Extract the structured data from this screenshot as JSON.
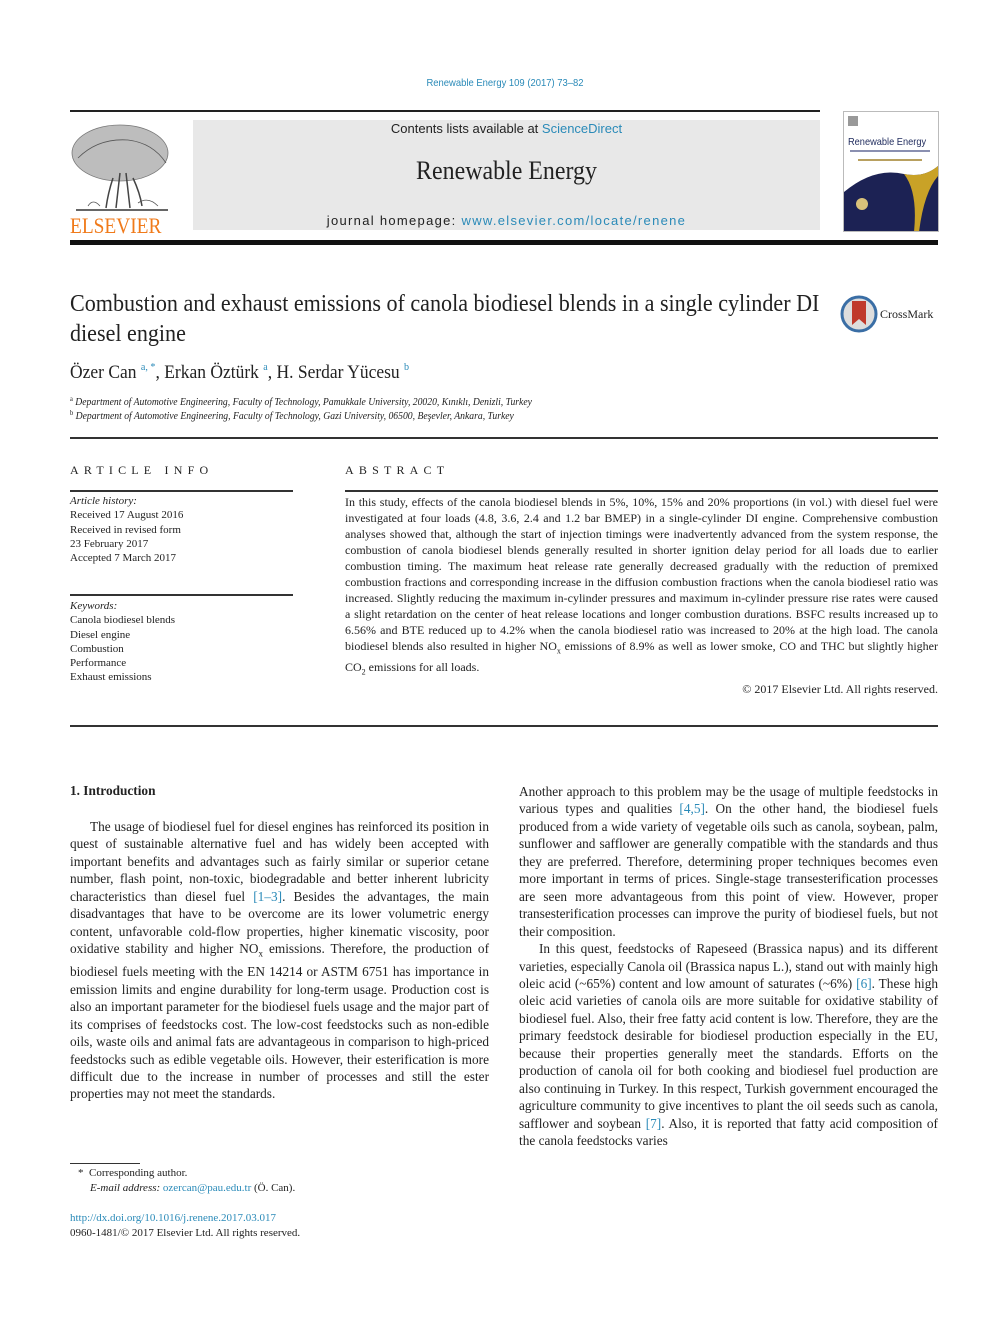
{
  "header": {
    "journal_ref": "Renewable Energy 109 (2017) 73–82",
    "contents_prefix": "Contents lists available at ",
    "contents_link": "ScienceDirect",
    "journal_name": "Renewable Energy",
    "homepage_prefix": "journal homepage: ",
    "homepage_link": "www.elsevier.com/locate/renene",
    "publisher_logo_text": "ELSEVIER",
    "cover_title": "Renewable Energy",
    "crossmark_label": "CrossMark"
  },
  "article": {
    "title": "Combustion and exhaust emissions of canola biodiesel blends in a single cylinder DI diesel engine",
    "authors": [
      {
        "name": "Özer Can",
        "affil": "a, *"
      },
      {
        "name": "Erkan Öztürk",
        "affil": "a"
      },
      {
        "name": "H. Serdar Yücesu",
        "affil": "b"
      }
    ],
    "affiliations": [
      {
        "mark": "a",
        "text": "Department of Automotive Engineering, Faculty of Technology, Pamukkale University, 20020, Kınıklı, Denizli, Turkey"
      },
      {
        "mark": "b",
        "text": "Department of Automotive Engineering, Faculty of Technology, Gazi University, 06500, Beşevler, Ankara, Turkey"
      }
    ]
  },
  "article_info": {
    "heading": "ARTICLE INFO",
    "history_label": "Article history:",
    "history": [
      "Received 17 August 2016",
      "Received in revised form",
      "23 February 2017",
      "Accepted 7 March 2017"
    ],
    "keywords_label": "Keywords:",
    "keywords": [
      "Canola biodiesel blends",
      "Diesel engine",
      "Combustion",
      "Performance",
      "Exhaust emissions"
    ]
  },
  "abstract": {
    "heading": "ABSTRACT",
    "text_1": "In this study, effects of the canola biodiesel blends in 5%, 10%, 15% and 20% proportions (in vol.) with diesel fuel were investigated at four loads (4.8, 3.6, 2.4 and 1.2 bar BMEP) in a single-cylinder DI engine. Comprehensive combustion analyses showed that, although the start of injection timings were inadvertently advanced from the system response, the combustion of canola biodiesel blends generally resulted in shorter ignition delay period for all loads due to earlier combustion timing. The maximum heat release rate generally decreased gradually with the reduction of premixed combustion fractions and corresponding increase in the diffusion combustion fractions when the canola biodiesel ratio was increased. Slightly reducing the maximum in-cylinder pressures and maximum in-cylinder pressure rise rates were caused a slight retardation on the center of heat release locations and longer combustion durations. BSFC results increased up to 6.56% and BTE reduced up to 4.2% when the canola biodiesel ratio was increased to 20% at the high load. The canola biodiesel blends also resulted in higher NO",
    "sub_1": "x",
    "text_2": " emissions of 8.9% as well as lower smoke, CO and THC but slightly higher CO",
    "sub_2": "2",
    "text_3": " emissions for all loads.",
    "copyright": "© 2017 Elsevier Ltd. All rights reserved."
  },
  "body": {
    "section_heading": "1.  Introduction",
    "left_p1_a": "The usage of biodiesel fuel for diesel engines has reinforced its position in quest of sustainable alternative fuel and has widely been accepted with important benefits and advantages such as fairly similar or superior cetane number, flash point, non-toxic, biodegradable and better inherent lubricity characteristics than diesel fuel ",
    "left_p1_ref": "[1–3]",
    "left_p1_b": ". Besides the advantages, the main disadvantages that have to be overcome are its lower volumetric energy content, unfavorable cold-flow properties, higher kinematic viscosity, poor oxidative stability and higher NO",
    "left_p1_sub": "x",
    "left_p1_c": " emissions. Therefore, the production of biodiesel fuels meeting with the EN 14214 or ASTM 6751 has importance in emission limits and engine durability for long-term usage. Production cost is also an important parameter for the biodiesel fuels usage and the major part of its comprises of feedstocks cost. The low-cost feedstocks such as non-edible oils, waste oils and animal fats are advantageous in comparison to high-priced feedstocks such as edible vegetable oils. However, their esterification is more difficult due to the increase in number of processes and still the ester properties may not meet the standards.",
    "right_p1_a": "Another approach to this problem may be the usage of multiple feedstocks in various types and qualities ",
    "right_p1_ref": "[4,5]",
    "right_p1_b": ". On the other hand, the biodiesel fuels produced from a wide variety of vegetable oils such as canola, soybean, palm, sunflower and safflower are generally compatible with the standards and thus they are preferred. Therefore, determining proper techniques becomes even more important in terms of prices. Single-stage transesterification processes are seen more advantageous from this point of view. However, proper transesterification processes can improve the purity of biodiesel fuels, but not their composition.",
    "right_p2_a": "In this quest, feedstocks of Rapeseed (Brassica napus) and its different varieties, especially Canola oil (Brassica napus L.), stand out with mainly high oleic acid (~65%) content and low amount of saturates (~6%) ",
    "right_p2_ref1": "[6]",
    "right_p2_b": ". These high oleic acid varieties of canola oils are more suitable for oxidative stability of biodiesel fuel. Also, their free fatty acid content is low. Therefore, they are the primary feedstock desirable for biodiesel production especially in the EU, because their properties generally meet the standards. Efforts on the production of canola oil for both cooking and biodiesel fuel production are also continuing in Turkey. In this respect, Turkish government encouraged the agriculture community to give incentives to plant the oil seeds such as canola, safflower and soybean ",
    "right_p2_ref2": "[7]",
    "right_p2_c": ". Also, it is reported that fatty acid composition of the canola feedstocks varies"
  },
  "footnotes": {
    "star": "*",
    "corresponding": "Corresponding author.",
    "email_label": "E-mail address: ",
    "email": "ozercan@pau.edu.tr",
    "email_suffix": " (Ö. Can).",
    "doi": "http://dx.doi.org/10.1016/j.renene.2017.03.017",
    "issn": "0960-1481/© 2017 Elsevier Ltd. All rights reserved."
  },
  "colors": {
    "link": "#2a8ab8",
    "elsevier_orange": "#f07a1a",
    "header_box": "#e8e8e8"
  }
}
